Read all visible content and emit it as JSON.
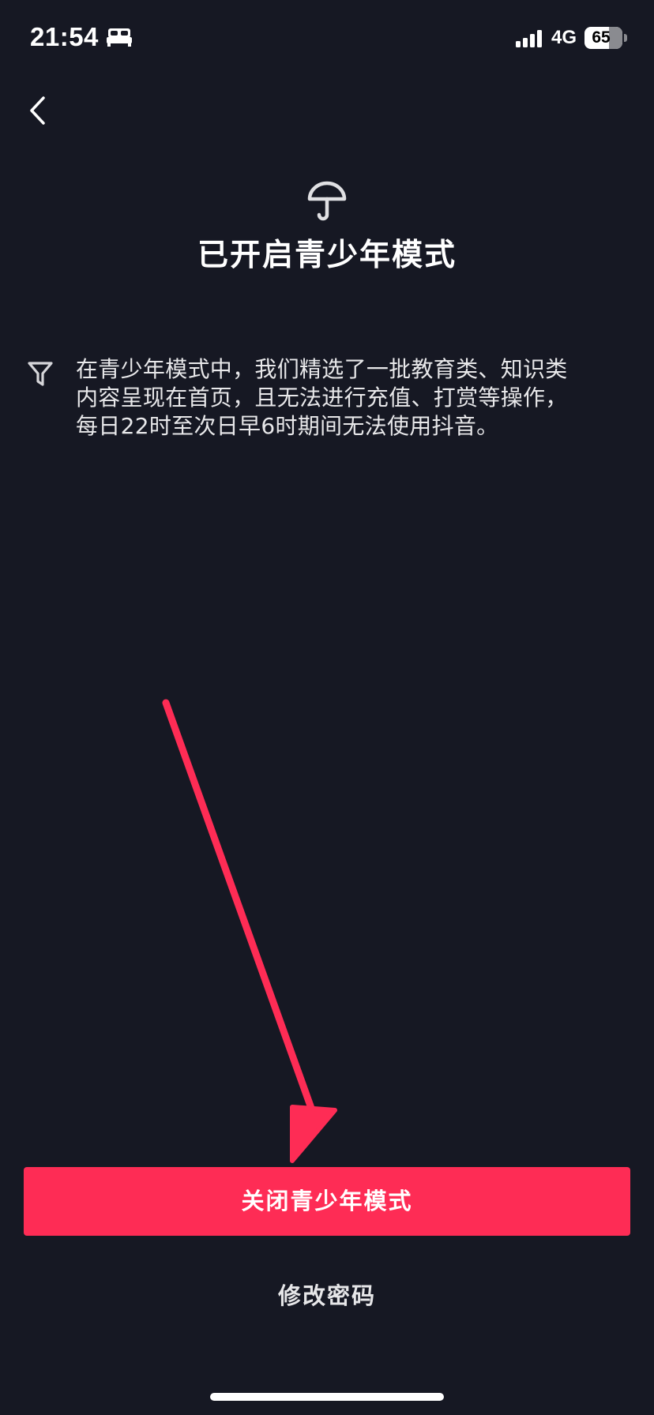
{
  "status_bar": {
    "time": "21:54",
    "network": "4G",
    "battery_percent": "65",
    "battery_level": 0.65,
    "icons": [
      "bed-icon",
      "signal-icon",
      "battery-icon"
    ]
  },
  "header": {
    "back_icon": "chevron-left-icon"
  },
  "main": {
    "icon": "umbrella-icon",
    "title": "已开启青少年模式",
    "info_icon": "filter-icon",
    "info_lines": [
      "在青少年模式中，我们精选了一批教育类、知识类",
      "内容呈现在首页，且无法进行充值、打赏等操作，",
      "每日22时至次日早6时期间无法使用抖音。"
    ]
  },
  "actions": {
    "close_mode_label": "关闭青少年模式",
    "change_password_label": "修改密码"
  },
  "colors": {
    "background": "#161823",
    "accent": "#fe2c55",
    "annotation_arrow": "#fe2c55"
  }
}
